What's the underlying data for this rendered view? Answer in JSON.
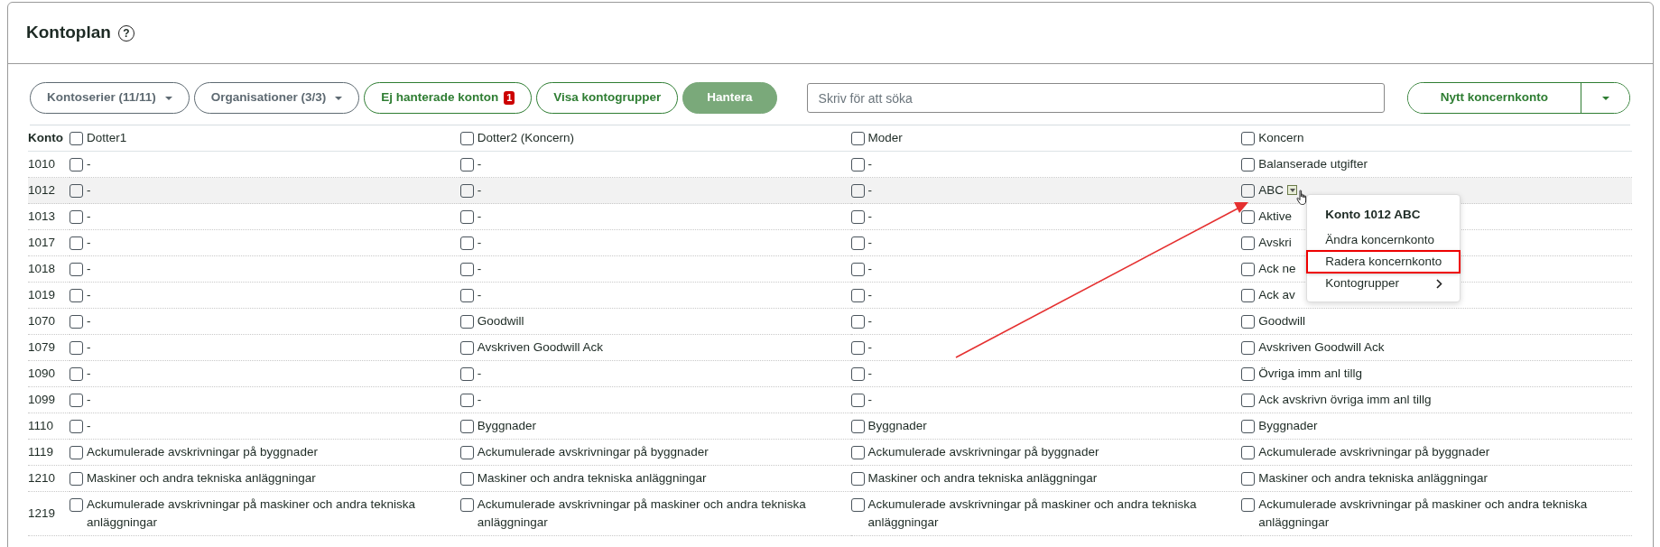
{
  "header": {
    "title": "Kontoplan",
    "help_glyph": "?"
  },
  "toolbar": [
    {
      "kind": "dropdown",
      "label": "Kontoserier (11/11)"
    },
    {
      "kind": "dropdown",
      "label": "Organisationer (3/3)"
    },
    {
      "kind": "outline",
      "label": "Ej hanterade konton",
      "badge": "1"
    },
    {
      "kind": "outline",
      "label": "Visa kontogrupper"
    },
    {
      "kind": "solid",
      "label": "Hantera"
    }
  ],
  "search": {
    "placeholder": "Skriv för att söka"
  },
  "split_button": {
    "label": "Nytt koncernkonto"
  },
  "table": {
    "first_column": "Konto",
    "columns": [
      {
        "label": "Dotter1",
        "checked": false
      },
      {
        "label": "Dotter2 (Koncern)",
        "checked": false
      },
      {
        "label": "Moder",
        "checked": false
      },
      {
        "label": "Koncern",
        "checked": false
      }
    ],
    "rows": [
      {
        "account": "1010",
        "hovered": false,
        "cells": [
          {
            "text": "-",
            "checked": false
          },
          {
            "text": "-",
            "checked": false
          },
          {
            "text": "-",
            "checked": false
          },
          {
            "text": "Balanserade utgifter",
            "checked": false
          }
        ]
      },
      {
        "account": "1012",
        "hovered": true,
        "cells": [
          {
            "text": "-",
            "checked": false
          },
          {
            "text": "-",
            "checked": false
          },
          {
            "text": "-",
            "checked": false
          },
          {
            "text": "ABC",
            "checked": false,
            "menu_toggle": true
          }
        ]
      },
      {
        "account": "1013",
        "hovered": false,
        "cells": [
          {
            "text": "-",
            "checked": false
          },
          {
            "text": "-",
            "checked": false
          },
          {
            "text": "-",
            "checked": false
          },
          {
            "text": "Aktive",
            "checked": false
          }
        ]
      },
      {
        "account": "1017",
        "hovered": false,
        "cells": [
          {
            "text": "-",
            "checked": false
          },
          {
            "text": "-",
            "checked": false
          },
          {
            "text": "-",
            "checked": false
          },
          {
            "text": "Avskri",
            "checked": false
          }
        ]
      },
      {
        "account": "1018",
        "hovered": false,
        "cells": [
          {
            "text": "-",
            "checked": false
          },
          {
            "text": "-",
            "checked": false
          },
          {
            "text": "-",
            "checked": false
          },
          {
            "text": "Ack ne",
            "checked": false
          }
        ]
      },
      {
        "account": "1019",
        "hovered": false,
        "cells": [
          {
            "text": "-",
            "checked": false
          },
          {
            "text": "-",
            "checked": false
          },
          {
            "text": "-",
            "checked": false
          },
          {
            "text": "Ack av",
            "checked": false
          }
        ]
      },
      {
        "account": "1070",
        "hovered": false,
        "cells": [
          {
            "text": "-",
            "checked": false
          },
          {
            "text": "Goodwill",
            "checked": false
          },
          {
            "text": "-",
            "checked": false
          },
          {
            "text": "Goodwill",
            "checked": false
          }
        ]
      },
      {
        "account": "1079",
        "hovered": false,
        "cells": [
          {
            "text": "-",
            "checked": false
          },
          {
            "text": "Avskriven Goodwill Ack",
            "checked": false
          },
          {
            "text": "-",
            "checked": false
          },
          {
            "text": "Avskriven Goodwill Ack",
            "checked": false
          }
        ]
      },
      {
        "account": "1090",
        "hovered": false,
        "cells": [
          {
            "text": "-",
            "checked": false
          },
          {
            "text": "-",
            "checked": false
          },
          {
            "text": "-",
            "checked": false
          },
          {
            "text": "Övriga imm anl tillg",
            "checked": false
          }
        ]
      },
      {
        "account": "1099",
        "hovered": false,
        "cells": [
          {
            "text": "-",
            "checked": false
          },
          {
            "text": "-",
            "checked": false
          },
          {
            "text": "-",
            "checked": false
          },
          {
            "text": "Ack avskrivn övriga imm anl tillg",
            "checked": false
          }
        ]
      },
      {
        "account": "1110",
        "hovered": false,
        "cells": [
          {
            "text": "-",
            "checked": false
          },
          {
            "text": "Byggnader",
            "checked": false
          },
          {
            "text": "Byggnader",
            "checked": false
          },
          {
            "text": "Byggnader",
            "checked": false
          }
        ]
      },
      {
        "account": "1119",
        "hovered": false,
        "cells": [
          {
            "text": "Ackumulerade avskrivningar på byggnader",
            "checked": false
          },
          {
            "text": "Ackumulerade avskrivningar på byggnader",
            "checked": false
          },
          {
            "text": "Ackumulerade avskrivningar på byggnader",
            "checked": false
          },
          {
            "text": "Ackumulerade avskrivningar på byggnader",
            "checked": false
          }
        ]
      },
      {
        "account": "1210",
        "hovered": false,
        "cells": [
          {
            "text": "Maskiner och andra tekniska anläggningar",
            "checked": false
          },
          {
            "text": "Maskiner och andra tekniska anläggningar",
            "checked": false
          },
          {
            "text": "Maskiner och andra tekniska anläggningar",
            "checked": false
          },
          {
            "text": "Maskiner och andra tekniska anläggningar",
            "checked": false
          }
        ]
      },
      {
        "account": "1219",
        "hovered": false,
        "cells": [
          {
            "text": "Ackumulerade avskrivningar på maskiner och andra tekniska anläggningar",
            "checked": false
          },
          {
            "text": "Ackumulerade avskrivningar på maskiner och andra tekniska anläggningar",
            "checked": false
          },
          {
            "text": "Ackumulerade avskrivningar på maskiner och andra tekniska anläggningar",
            "checked": false
          },
          {
            "text": "Ackumulerade avskrivningar på maskiner och andra tekniska anläggningar",
            "checked": false
          }
        ]
      }
    ]
  },
  "context_menu": {
    "title": "Konto 1012 ABC",
    "items": [
      {
        "label": "Ändra koncernkonto",
        "highlighted": false,
        "submenu": false
      },
      {
        "label": "Radera koncernkonto",
        "highlighted": true,
        "submenu": false
      },
      {
        "label": "Kontogrupper",
        "highlighted": false,
        "submenu": true
      }
    ]
  },
  "annotation_arrow": true
}
